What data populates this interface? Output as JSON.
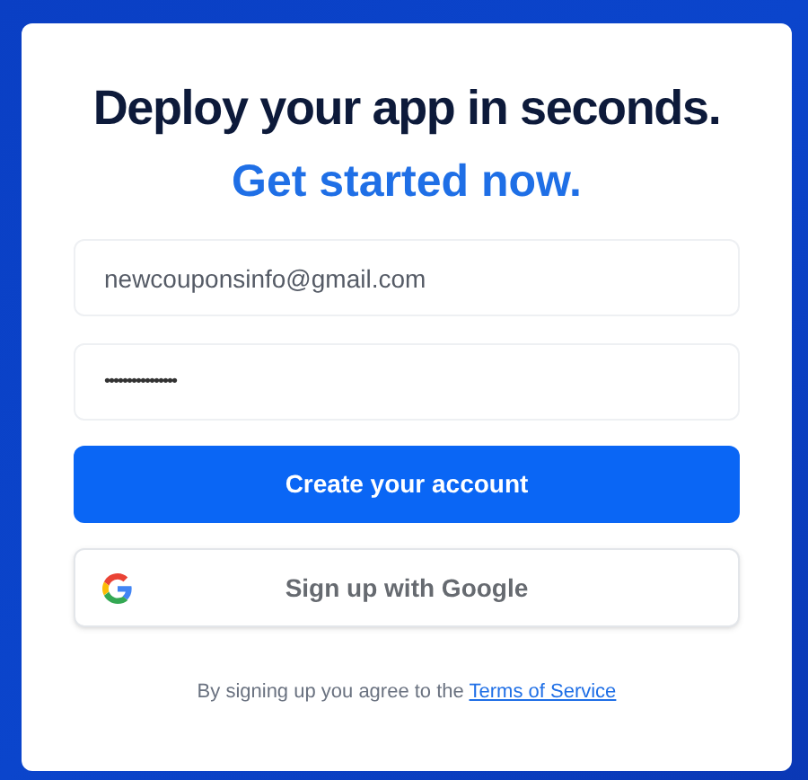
{
  "heading": "Deploy your app in seconds.",
  "subheading": "Get started now.",
  "email_field": {
    "value": "newcouponsinfo@gmail.com"
  },
  "password_field": {
    "value": "••••••••••••••••"
  },
  "buttons": [
    {
      "kind": "primary",
      "label": "Create your account"
    },
    {
      "kind": "google",
      "label": "Sign up with Google"
    }
  ],
  "footer": {
    "text": "By signing up you agree to the",
    "link": "Terms of Service"
  }
}
